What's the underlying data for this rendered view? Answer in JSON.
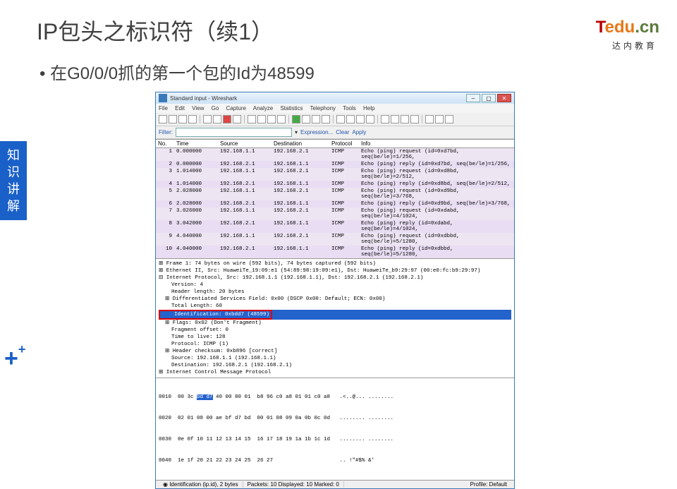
{
  "slide": {
    "title": "IP包头之标识符（续1）",
    "bullet": "在G0/0/0抓的第一个包的Id为48599"
  },
  "brand": {
    "t": "T",
    "edu": "edu",
    "cn": ".cn",
    "sub": "达内教育"
  },
  "sidebar": "知识讲解",
  "win": {
    "title": "Standard input - Wireshark",
    "menus": [
      "File",
      "Edit",
      "View",
      "Go",
      "Capture",
      "Analyze",
      "Statistics",
      "Telephony",
      "Tools",
      "Help"
    ],
    "filter_label": "Filter:",
    "filter_placeholder": "",
    "filter_btns": [
      "Expression...",
      "Clear",
      "Apply"
    ],
    "cols": [
      "No.",
      "Time",
      "Source",
      "Destination",
      "Protocol",
      "Info"
    ],
    "rows": [
      {
        "no": "1",
        "time": "0.000000",
        "src": "192.168.1.1",
        "dst": "192.168.2.1",
        "prot": "ICMP",
        "info": "Echo (ping) request  (id=0xd7bd, seq(be/le)=1/256,"
      },
      {
        "no": "2",
        "time": "0.000000",
        "src": "192.168.2.1",
        "dst": "192.168.1.1",
        "prot": "ICMP",
        "info": "Echo (ping) reply    (id=0xd7bd, seq(be/le)=1/256,"
      },
      {
        "no": "3",
        "time": "1.014000",
        "src": "192.168.1.1",
        "dst": "192.168.2.1",
        "prot": "ICMP",
        "info": "Echo (ping) request  (id=0xd8bd, seq(be/le)=2/512,"
      },
      {
        "no": "4",
        "time": "1.014000",
        "src": "192.168.2.1",
        "dst": "192.168.1.1",
        "prot": "ICMP",
        "info": "Echo (ping) reply    (id=0xd8bd, seq(be/le)=2/512,"
      },
      {
        "no": "5",
        "time": "2.028000",
        "src": "192.168.1.1",
        "dst": "192.168.2.1",
        "prot": "ICMP",
        "info": "Echo (ping) request  (id=0xd9bd, seq(be/le)=3/768,"
      },
      {
        "no": "6",
        "time": "2.028000",
        "src": "192.168.2.1",
        "dst": "192.168.1.1",
        "prot": "ICMP",
        "info": "Echo (ping) reply    (id=0xd9bd, seq(be/le)=3/768,"
      },
      {
        "no": "7",
        "time": "3.026000",
        "src": "192.168.1.1",
        "dst": "192.168.2.1",
        "prot": "ICMP",
        "info": "Echo (ping) request  (id=0xdabd, seq(be/le)=4/1024,"
      },
      {
        "no": "8",
        "time": "3.042000",
        "src": "192.168.2.1",
        "dst": "192.168.1.1",
        "prot": "ICMP",
        "info": "Echo (ping) reply    (id=0xdabd, seq(be/le)=4/1024,"
      },
      {
        "no": "9",
        "time": "4.040000",
        "src": "192.168.1.1",
        "dst": "192.168.2.1",
        "prot": "ICMP",
        "info": "Echo (ping) request  (id=0xdbbd, seq(be/le)=5/1280,"
      },
      {
        "no": "10",
        "time": "4.040000",
        "src": "192.168.2.1",
        "dst": "192.168.1.1",
        "prot": "ICMP",
        "info": "Echo (ping) reply    (id=0xdbbd, seq(be/le)=5/1280,"
      }
    ],
    "detail": {
      "l1": "⊞ Frame 1: 74 bytes on wire (592 bits), 74 bytes captured (592 bits)",
      "l2": "⊞ Ethernet II, Src: HuaweiTe_19:09:e1 (54:89:98:19:09:e1), Dst: HuaweiTe_b9:29:97 (00:e0:fc:b9:29:97)",
      "l3": "⊟ Internet Protocol, Src: 192.168.1.1 (192.168.1.1), Dst: 192.168.2.1 (192.168.2.1)",
      "l4": "    Version: 4",
      "l5": "    Header length: 20 bytes",
      "l6": "  ⊞ Differentiated Services Field: 0x00 (DSCP 0x00: Default; ECN: 0x00)",
      "l7": "    Total Length: 60",
      "l8_sel": "    Identification: 0xbdd7 (48599)",
      "l9": "  ⊞ Flags: 0x02 (Don't Fragment)",
      "l10": "    Fragment offset: 0",
      "l11": "    Time to live: 128",
      "l12": "    Protocol: ICMP (1)",
      "l13": "  ⊞ Header checksum: 0xb896 [correct]",
      "l14": "    Source: 192.168.1.1 (192.168.1.1)",
      "l15": "    Destination: 192.168.2.1 (192.168.2.1)",
      "l16": "⊞ Internet Control Message Protocol"
    },
    "hex": {
      "r1a": "0010  00 3c ",
      "r1b": "bd d7",
      "r1c": " 40 00 80 01  b8 96 c0 a8 01 01 c0 a8   .<..@... ........",
      "r2": "0020  02 01 08 00 ae bf d7 bd  00 01 08 09 0a 0b 0c 0d   ........ ........",
      "r3": "0030  0e 0f 10 11 12 13 14 15  16 17 18 19 1a 1b 1c 1d   ........ ........",
      "r4": "0040  1e 1f 20 21 22 23 24 25  26 27                     .. !\"#$% &'"
    },
    "status": {
      "s1": "Identification (ip.id), 2 bytes",
      "s2": "Packets: 10 Displayed: 10 Marked: 0",
      "s3": "Profile: Default"
    }
  }
}
